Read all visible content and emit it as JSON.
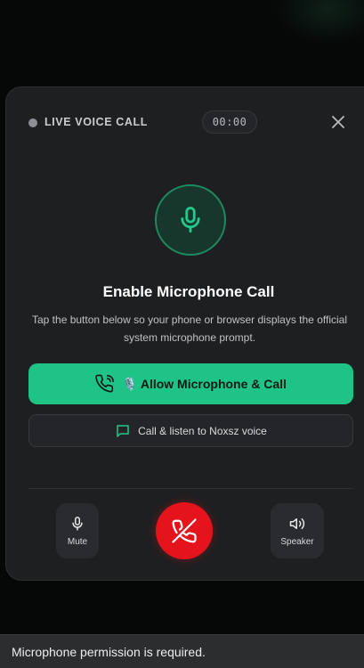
{
  "call": {
    "status_label": "LIVE VOICE CALL",
    "timer": "00:00"
  },
  "prompt": {
    "title": "Enable Microphone Call",
    "description": "Tap the button below so your phone or browser displays the official system microphone prompt."
  },
  "buttons": {
    "allow_label": "🎙️ Allow Microphone & Call",
    "listen_label": "Call & listen to Noxsz voice"
  },
  "controls": {
    "mute_label": "Mute",
    "speaker_label": "Speaker"
  },
  "toast": {
    "message": "Microphone permission is required."
  },
  "icons": {
    "status": "status-dot-icon",
    "close": "close-icon",
    "hero": "microphone-icon",
    "allow": "phone-call-icon",
    "listen": "chat-bubble-icon",
    "mute": "microphone-icon",
    "hangup": "phone-hangup-icon",
    "speaker": "speaker-icon"
  },
  "colors": {
    "accent": "#1ec386",
    "hangup": "#e5131b",
    "card": "#1e1f21",
    "background": "#060808"
  }
}
